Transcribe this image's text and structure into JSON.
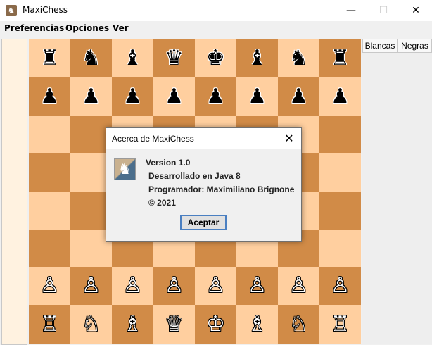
{
  "window": {
    "title": "MaxiChess",
    "icon": "chess-knight-icon",
    "minimize_glyph": "—",
    "maximize_glyph": "☐",
    "close_glyph": "✕"
  },
  "menubar": {
    "items": [
      {
        "label": "Preferencias",
        "mnemonic": ""
      },
      {
        "label": "Opciones",
        "mnemonic": "O"
      },
      {
        "label": "Ver",
        "mnemonic": ""
      }
    ]
  },
  "board": {
    "light_color": "#ffcf9f",
    "dark_color": "#d18b47",
    "rows": [
      [
        {
          "p": "♜",
          "s": "b"
        },
        {
          "p": "♞",
          "s": "b"
        },
        {
          "p": "♝",
          "s": "b"
        },
        {
          "p": "♛",
          "s": "b"
        },
        {
          "p": "♚",
          "s": "b"
        },
        {
          "p": "♝",
          "s": "b"
        },
        {
          "p": "♞",
          "s": "b"
        },
        {
          "p": "♜",
          "s": "b"
        }
      ],
      [
        {
          "p": "♟",
          "s": "b"
        },
        {
          "p": "♟",
          "s": "b"
        },
        {
          "p": "♟",
          "s": "b"
        },
        {
          "p": "♟",
          "s": "b"
        },
        {
          "p": "♟",
          "s": "b"
        },
        {
          "p": "♟",
          "s": "b"
        },
        {
          "p": "♟",
          "s": "b"
        },
        {
          "p": "♟",
          "s": "b"
        }
      ],
      [
        {
          "p": "",
          "s": ""
        },
        {
          "p": "",
          "s": ""
        },
        {
          "p": "",
          "s": ""
        },
        {
          "p": "",
          "s": ""
        },
        {
          "p": "",
          "s": ""
        },
        {
          "p": "",
          "s": ""
        },
        {
          "p": "",
          "s": ""
        },
        {
          "p": "",
          "s": ""
        }
      ],
      [
        {
          "p": "",
          "s": ""
        },
        {
          "p": "",
          "s": ""
        },
        {
          "p": "",
          "s": ""
        },
        {
          "p": "",
          "s": ""
        },
        {
          "p": "",
          "s": ""
        },
        {
          "p": "",
          "s": ""
        },
        {
          "p": "",
          "s": ""
        },
        {
          "p": "",
          "s": ""
        }
      ],
      [
        {
          "p": "",
          "s": ""
        },
        {
          "p": "",
          "s": ""
        },
        {
          "p": "",
          "s": ""
        },
        {
          "p": "",
          "s": ""
        },
        {
          "p": "",
          "s": ""
        },
        {
          "p": "",
          "s": ""
        },
        {
          "p": "",
          "s": ""
        },
        {
          "p": "",
          "s": ""
        }
      ],
      [
        {
          "p": "",
          "s": ""
        },
        {
          "p": "",
          "s": ""
        },
        {
          "p": "",
          "s": ""
        },
        {
          "p": "",
          "s": ""
        },
        {
          "p": "",
          "s": ""
        },
        {
          "p": "",
          "s": ""
        },
        {
          "p": "",
          "s": ""
        },
        {
          "p": "",
          "s": ""
        }
      ],
      [
        {
          "p": "♙",
          "s": "w"
        },
        {
          "p": "♙",
          "s": "w"
        },
        {
          "p": "♙",
          "s": "w"
        },
        {
          "p": "♙",
          "s": "w"
        },
        {
          "p": "♙",
          "s": "w"
        },
        {
          "p": "♙",
          "s": "w"
        },
        {
          "p": "♙",
          "s": "w"
        },
        {
          "p": "♙",
          "s": "w"
        }
      ],
      [
        {
          "p": "♖",
          "s": "w"
        },
        {
          "p": "♘",
          "s": "w"
        },
        {
          "p": "♗",
          "s": "w"
        },
        {
          "p": "♕",
          "s": "w"
        },
        {
          "p": "♔",
          "s": "w"
        },
        {
          "p": "♗",
          "s": "w"
        },
        {
          "p": "♘",
          "s": "w"
        },
        {
          "p": "♖",
          "s": "w"
        }
      ]
    ]
  },
  "moves_panel": {
    "columns": [
      "Blancas",
      "Negras"
    ]
  },
  "about_dialog": {
    "title": "Acerca de MaxiChess",
    "icon": "chess-knight-icon",
    "close_glyph": "✕",
    "lines": [
      "Version 1.0",
      "Desarrollado en Java 8",
      "Programador: Maximiliano Brignone",
      "© 2021"
    ],
    "ok_label": "Aceptar"
  }
}
